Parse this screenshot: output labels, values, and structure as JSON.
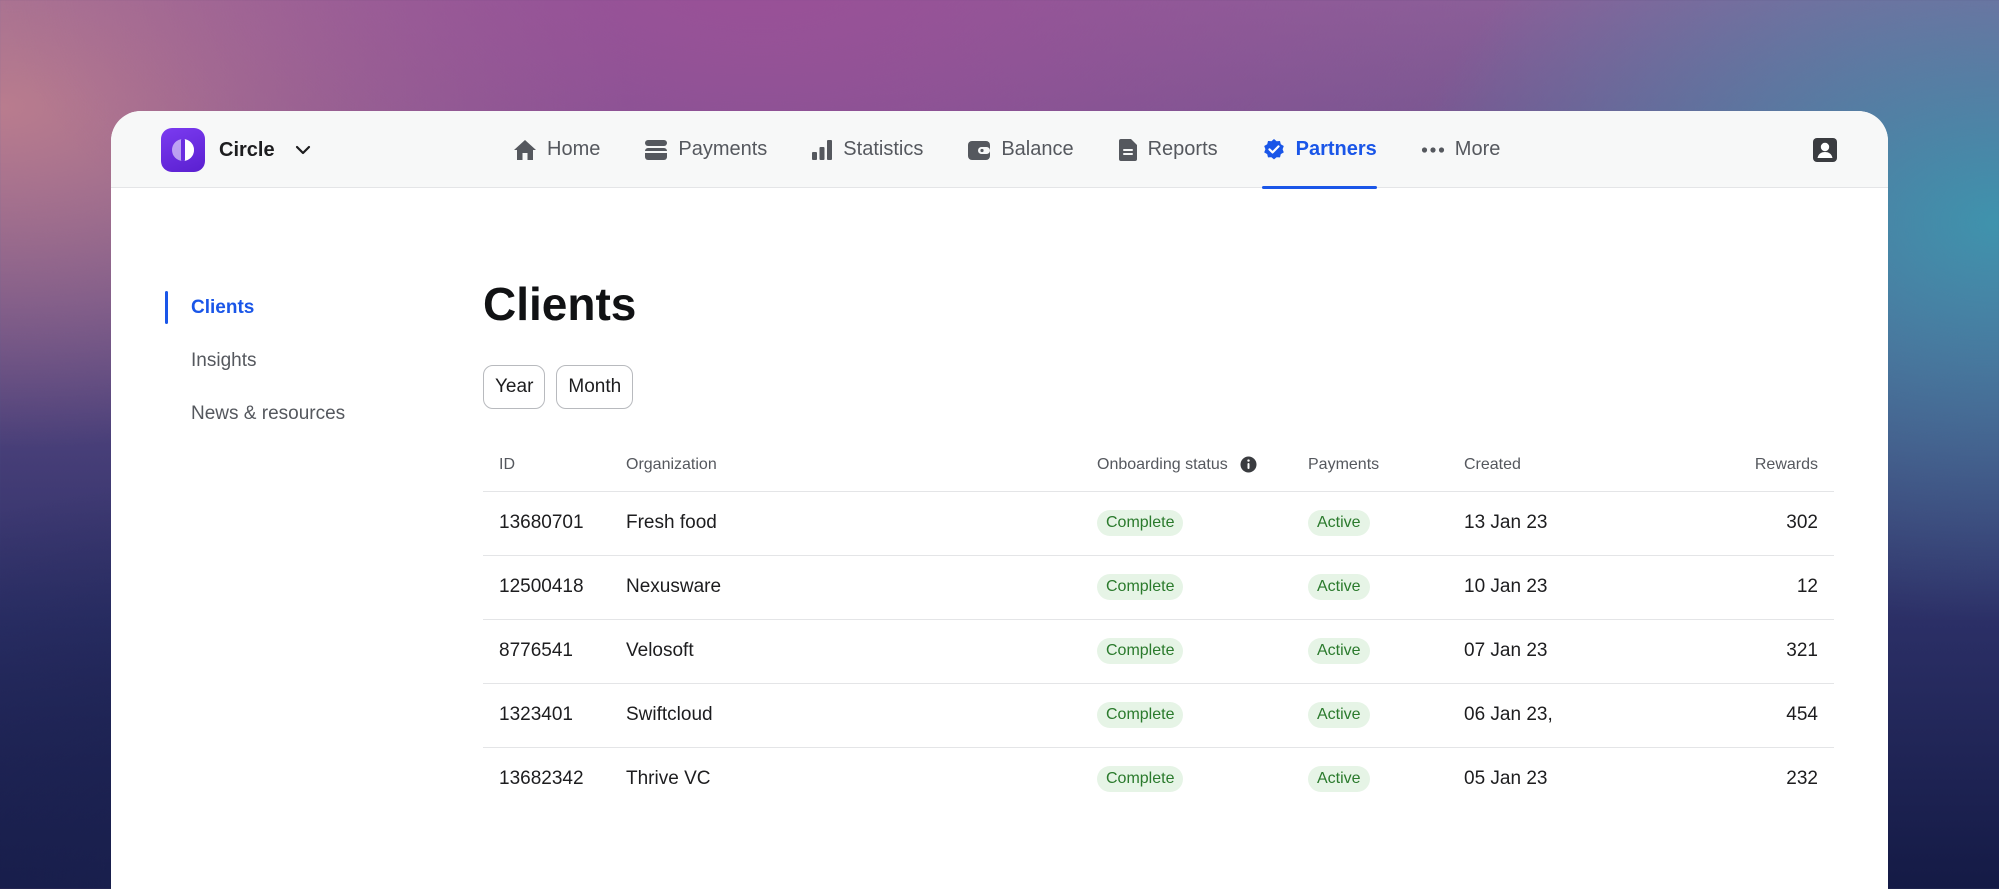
{
  "brand": {
    "name": "Circle"
  },
  "nav": [
    {
      "label": "Home",
      "icon": "home-icon"
    },
    {
      "label": "Payments",
      "icon": "payments-icon"
    },
    {
      "label": "Statistics",
      "icon": "bar-chart-icon"
    },
    {
      "label": "Balance",
      "icon": "wallet-icon"
    },
    {
      "label": "Reports",
      "icon": "document-icon"
    },
    {
      "label": "Partners",
      "icon": "verified-badge-icon",
      "active": true
    },
    {
      "label": "More",
      "icon": "more-dots-icon"
    }
  ],
  "sidebar": {
    "items": [
      {
        "label": "Clients",
        "active": true
      },
      {
        "label": "Insights"
      },
      {
        "label": "News & resources"
      }
    ]
  },
  "main": {
    "title": "Clients",
    "filters": [
      "Year",
      "Month"
    ]
  },
  "table": {
    "columns": [
      "ID",
      "Organization",
      "Onboarding status",
      "Payments",
      "Created",
      "Rewards"
    ],
    "rows": [
      {
        "id": "13680701",
        "organization": "Fresh food",
        "onboarding": "Complete",
        "payments": "Active",
        "created": "13 Jan 23",
        "rewards": "302"
      },
      {
        "id": "12500418",
        "organization": "Nexusware",
        "onboarding": "Complete",
        "payments": "Active",
        "created": "10 Jan 23",
        "rewards": "12"
      },
      {
        "id": "8776541",
        "organization": "Velosoft",
        "onboarding": "Complete",
        "payments": "Active",
        "created": "07 Jan 23",
        "rewards": "321"
      },
      {
        "id": "1323401",
        "organization": "Swiftcloud",
        "onboarding": "Complete",
        "payments": "Active",
        "created": "06 Jan 23,",
        "rewards": "454"
      },
      {
        "id": "13682342",
        "organization": "Thrive VC",
        "onboarding": "Complete",
        "payments": "Active",
        "created": "05 Jan 23",
        "rewards": "232"
      }
    ]
  },
  "colors": {
    "accent": "#1a56e8",
    "brand": "#6a2ee0",
    "badge_bg": "#e6f4e6",
    "badge_text": "#2a7a2c"
  }
}
